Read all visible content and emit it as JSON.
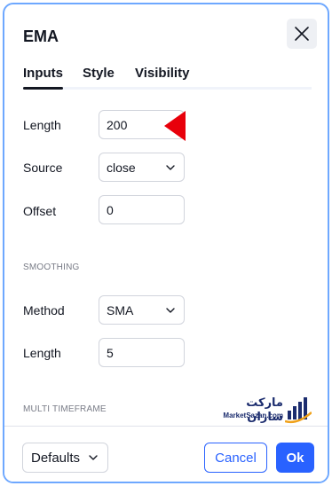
{
  "dialog": {
    "title": "EMA",
    "close_icon": "close-icon"
  },
  "tabs": [
    {
      "label": "Inputs",
      "active": true
    },
    {
      "label": "Style",
      "active": false
    },
    {
      "label": "Visibility",
      "active": false
    }
  ],
  "inputs": {
    "length": {
      "label": "Length",
      "value": "200"
    },
    "source": {
      "label": "Source",
      "value": "close"
    },
    "offset": {
      "label": "Offset",
      "value": "0"
    }
  },
  "smoothing": {
    "section_label": "SMOOTHING",
    "method": {
      "label": "Method",
      "value": "SMA"
    },
    "length": {
      "label": "Length",
      "value": "5"
    }
  },
  "multi_timeframe": {
    "section_label": "MULTI TIMEFRAME"
  },
  "watermark": {
    "name_fa": "مارکت سازان",
    "name_en": "MarketSazan",
    "domain": ".com"
  },
  "footer": {
    "defaults_label": "Defaults",
    "cancel_label": "Cancel",
    "ok_label": "Ok"
  },
  "colors": {
    "accent": "#2962ff",
    "pointer": "#e8000b",
    "frame_border": "#6ea8ff"
  },
  "annotation_icon": "red-triangle-pointer-icon"
}
